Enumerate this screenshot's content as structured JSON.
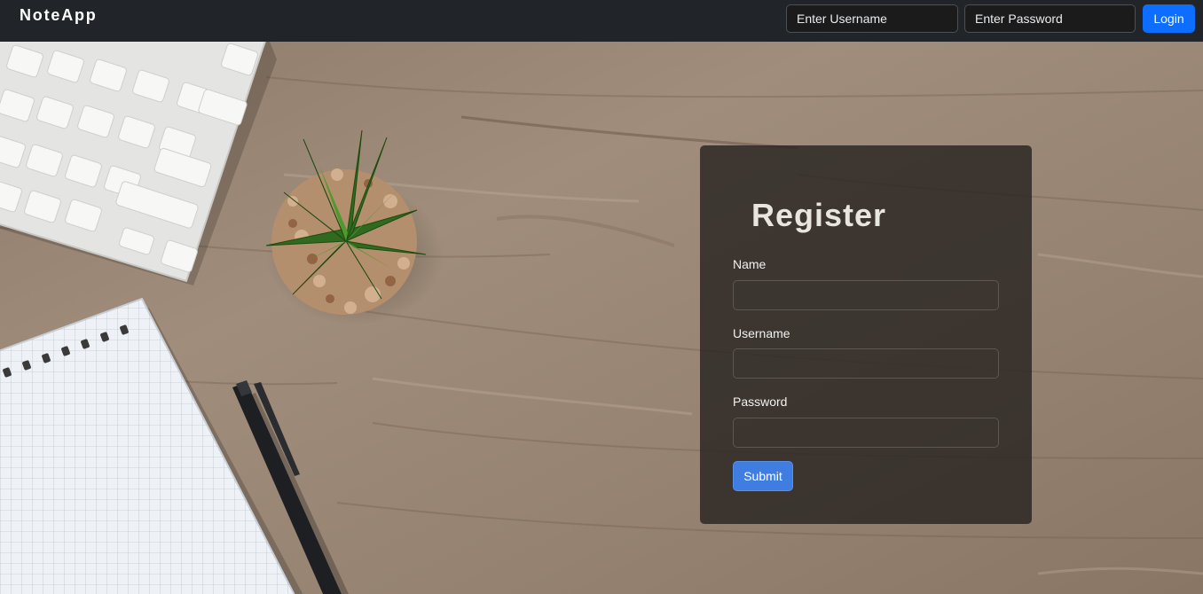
{
  "navbar": {
    "brand": "NoteApp",
    "username_placeholder": "Enter Username",
    "password_placeholder": "Enter Password",
    "login_label": "Login"
  },
  "register": {
    "title": "Register",
    "fields": [
      {
        "label": "Name",
        "value": ""
      },
      {
        "label": "Username",
        "value": ""
      },
      {
        "label": "Password",
        "value": ""
      }
    ],
    "submit_label": "Submit"
  },
  "colors": {
    "navbar_bg": "#212529",
    "primary": "#0d6efd",
    "card_bg": "#26221f",
    "desk_wood": "#9c8a78"
  }
}
